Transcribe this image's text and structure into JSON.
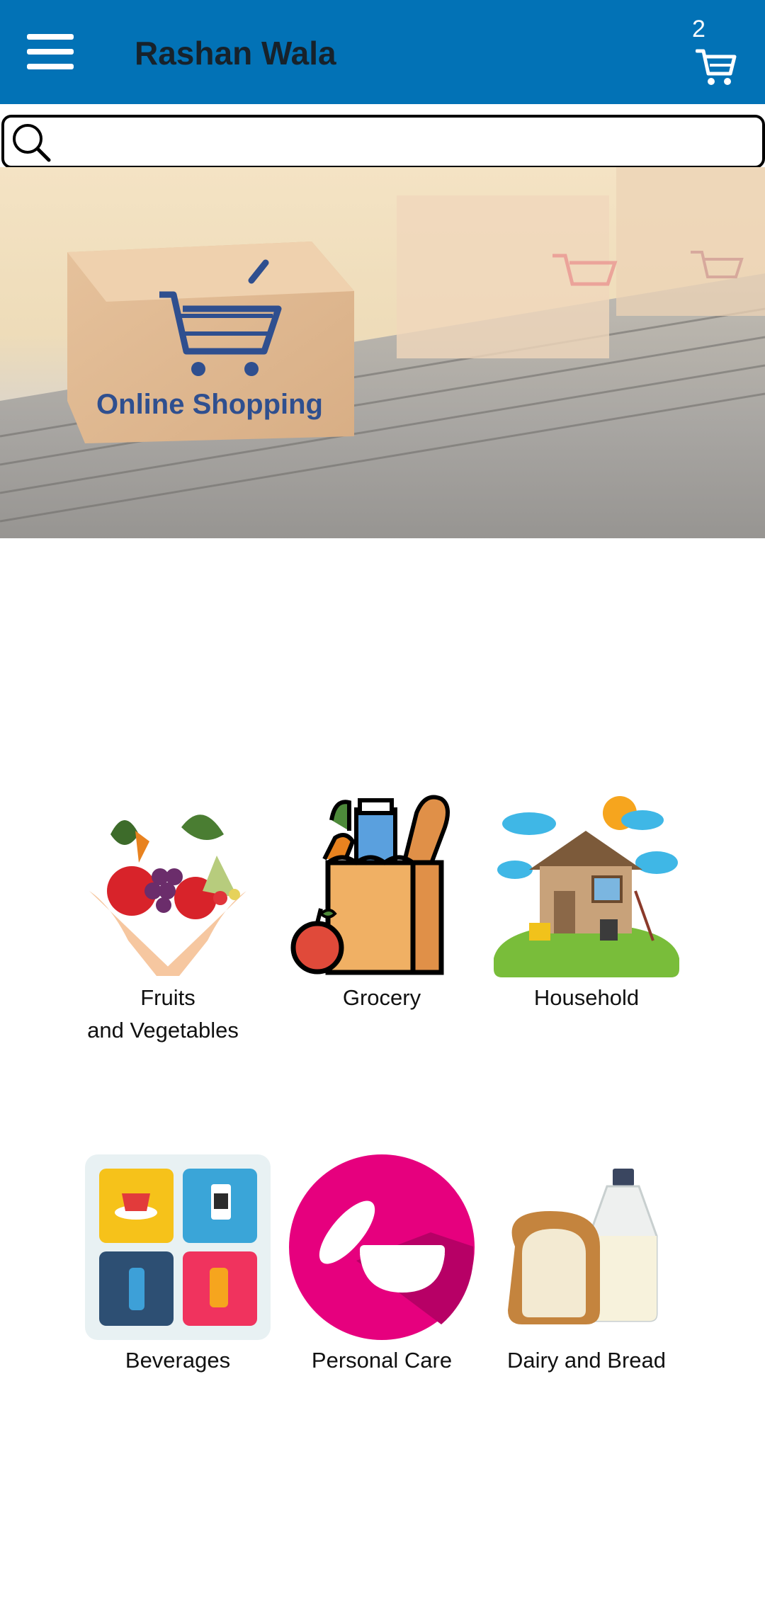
{
  "header": {
    "title": "Rashan Wala",
    "cart_count": "2",
    "menu_icon": "hamburger-menu-icon",
    "cart_icon": "shopping-cart-icon",
    "background": "#0272b6"
  },
  "search": {
    "value": "",
    "placeholder": "",
    "icon": "search-icon"
  },
  "banner": {
    "text": "Online Shopping"
  },
  "categories": [
    {
      "label_line1": "Fruits",
      "label_line2": "and Vegetables"
    },
    {
      "label": "Grocery"
    },
    {
      "label": "Household"
    },
    {
      "label": "Beverages"
    },
    {
      "label": "Personal Care"
    },
    {
      "label": "Dairy and Bread"
    }
  ]
}
